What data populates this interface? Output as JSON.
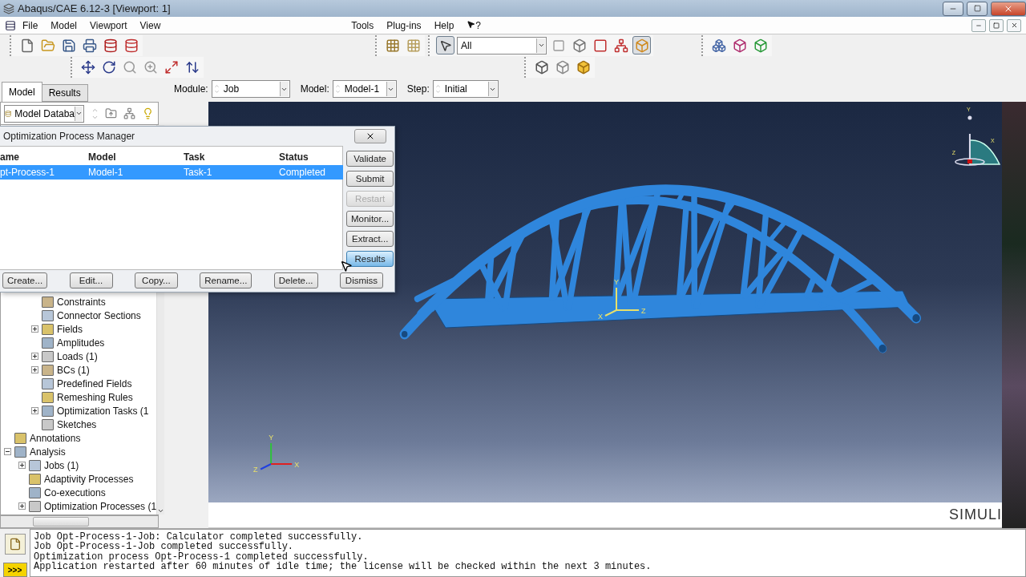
{
  "window": {
    "title": "Abaqus/CAE 6.12-3 [Viewport: 1]"
  },
  "menu": {
    "left": [
      "File",
      "Model",
      "Viewport",
      "View"
    ],
    "right": [
      "Tools",
      "Plug-ins",
      "Help"
    ],
    "help_pointer": "?"
  },
  "toolbar": {
    "selection_filter": "All"
  },
  "tabs": [
    {
      "label": "Model",
      "selected": true
    },
    {
      "label": "Results",
      "selected": false
    }
  ],
  "context_bar": [
    {
      "label": "Module:",
      "value": "Job"
    },
    {
      "label": "Model:",
      "value": "Model-1"
    },
    {
      "label": "Step:",
      "value": "Initial"
    }
  ],
  "tree_toolbar": {
    "database": "Model Databa"
  },
  "tree": {
    "model_items": [
      {
        "label": "Constraints",
        "expandable": false
      },
      {
        "label": "Connector Sections",
        "expandable": false
      },
      {
        "label": "Fields",
        "expandable": true
      },
      {
        "label": "Amplitudes",
        "expandable": false
      },
      {
        "label": "Loads (1)",
        "expandable": true
      },
      {
        "label": "BCs (1)",
        "expandable": true
      },
      {
        "label": "Predefined Fields",
        "expandable": false
      },
      {
        "label": "Remeshing Rules",
        "expandable": false
      },
      {
        "label": "Optimization Tasks (1",
        "expandable": true
      },
      {
        "label": "Sketches",
        "expandable": false
      }
    ],
    "items": [
      {
        "label": "Annotations",
        "expandable": false
      },
      {
        "label": "Analysis",
        "expandable": true,
        "expanded": true,
        "children": [
          {
            "label": "Jobs (1)",
            "expandable": true
          },
          {
            "label": "Adaptivity Processes",
            "expandable": false
          },
          {
            "label": "Co-executions",
            "expandable": false
          },
          {
            "label": "Optimization Processes (1",
            "expandable": true
          }
        ]
      }
    ]
  },
  "dialog": {
    "title": "Optimization Process Manager",
    "columns": [
      "ame",
      "Model",
      "Task",
      "Status"
    ],
    "rows": [
      {
        "cells": [
          "pt-Process-1",
          "Model-1",
          "Task-1",
          "Completed"
        ],
        "selected": true
      }
    ],
    "side_buttons": [
      {
        "label": "Validate",
        "disabled": false,
        "focused": false
      },
      {
        "label": "Submit",
        "disabled": false,
        "focused": false
      },
      {
        "label": "Restart",
        "disabled": true,
        "focused": false
      },
      {
        "label": "Monitor...",
        "disabled": false,
        "focused": false
      },
      {
        "label": "Extract...",
        "disabled": false,
        "focused": false
      },
      {
        "label": "Results",
        "disabled": false,
        "focused": true
      }
    ],
    "bottom_buttons": [
      "Create...",
      "Edit...",
      "Copy...",
      "Rename...",
      "Delete...",
      "Dismiss"
    ]
  },
  "viewport": {
    "view_triad": [
      "Y",
      "Z",
      "X"
    ],
    "part_axes": [
      "Y",
      "X",
      "Z"
    ],
    "global_triad": [
      "Y",
      "Z",
      "X"
    ],
    "logo": "SIMULI"
  },
  "messages": {
    "prompt_key": ">>>",
    "lines": [
      "Job Opt-Process-1-Job: Calculator completed successfully.",
      "Job Opt-Process-1-Job completed successfully.",
      "Optimization process Opt-Process-1 completed successfully.",
      "Application restarted after 60 minutes of idle time; the license will be checked within the next 3 minutes."
    ]
  }
}
